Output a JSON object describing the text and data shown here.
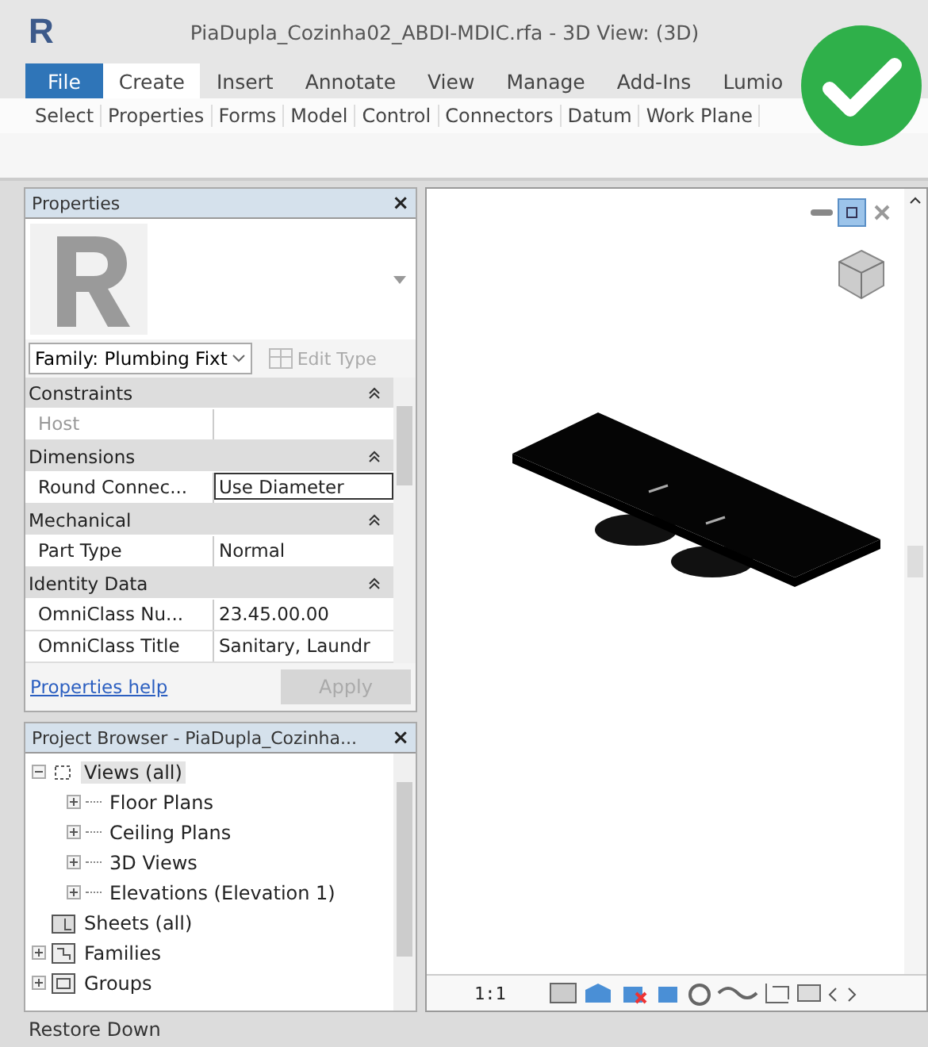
{
  "window": {
    "logo": "R",
    "title": "PiaDupla_Cozinha02_ABDI-MDIC.rfa - 3D View: (3D)"
  },
  "ribbon": {
    "tabs": [
      {
        "label": "File",
        "kind": "file",
        "selected": false
      },
      {
        "label": "Create",
        "kind": "tab",
        "selected": true
      },
      {
        "label": "Insert",
        "kind": "tab",
        "selected": false
      },
      {
        "label": "Annotate",
        "kind": "tab",
        "selected": false
      },
      {
        "label": "View",
        "kind": "tab",
        "selected": false
      },
      {
        "label": "Manage",
        "kind": "tab",
        "selected": false
      },
      {
        "label": "Add-Ins",
        "kind": "tab",
        "selected": false
      },
      {
        "label": "Lumio",
        "kind": "tab",
        "selected": false
      }
    ],
    "panels": [
      "Select",
      "Properties",
      "Forms",
      "Model",
      "Control",
      "Connectors",
      "Datum",
      "Work Plane"
    ]
  },
  "properties": {
    "title": "Properties",
    "close": "×",
    "type_selector": "Family: Plumbing Fixt",
    "edit_type": {
      "label": "Edit Type",
      "disabled": true
    },
    "groups": [
      {
        "name": "Constraints",
        "rows": [
          {
            "name": "Host",
            "value": "",
            "disabled": true,
            "kind": "text"
          }
        ]
      },
      {
        "name": "Dimensions",
        "rows": [
          {
            "name": "Round Connec...",
            "value": "Use Diameter",
            "disabled": false,
            "kind": "field"
          }
        ]
      },
      {
        "name": "Mechanical",
        "rows": [
          {
            "name": "Part Type",
            "value": "Normal",
            "disabled": false,
            "kind": "text"
          }
        ]
      },
      {
        "name": "Identity Data",
        "rows": [
          {
            "name": "OmniClass Nu...",
            "value": "23.45.00.00",
            "disabled": false,
            "kind": "text"
          },
          {
            "name": "OmniClass Title",
            "value": "Sanitary, Laundr",
            "disabled": false,
            "kind": "text"
          }
        ]
      }
    ],
    "help_link": "Properties help",
    "apply": {
      "label": "Apply",
      "disabled": true
    }
  },
  "project_browser": {
    "title": "Project Browser - PiaDupla_Cozinha...",
    "close": "×",
    "tree": [
      {
        "label": "Views (all)",
        "kind": "views",
        "expanded": true,
        "selected": true,
        "children": [
          {
            "label": "Floor Plans",
            "expanded": false,
            "selected": false
          },
          {
            "label": "Ceiling Plans",
            "expanded": false,
            "selected": false
          },
          {
            "label": "3D Views",
            "expanded": false,
            "selected": false
          },
          {
            "label": "Elevations (Elevation 1)",
            "expanded": false,
            "selected": false
          }
        ]
      },
      {
        "label": "Sheets (all)",
        "kind": "sheets",
        "selected": false
      },
      {
        "label": "Families",
        "kind": "families",
        "expanded": false,
        "selected": false
      },
      {
        "label": "Groups",
        "kind": "groups",
        "expanded": false,
        "selected": false
      }
    ]
  },
  "viewport": {
    "scale": "1:1"
  },
  "status_bar": {
    "text": "Restore Down"
  }
}
